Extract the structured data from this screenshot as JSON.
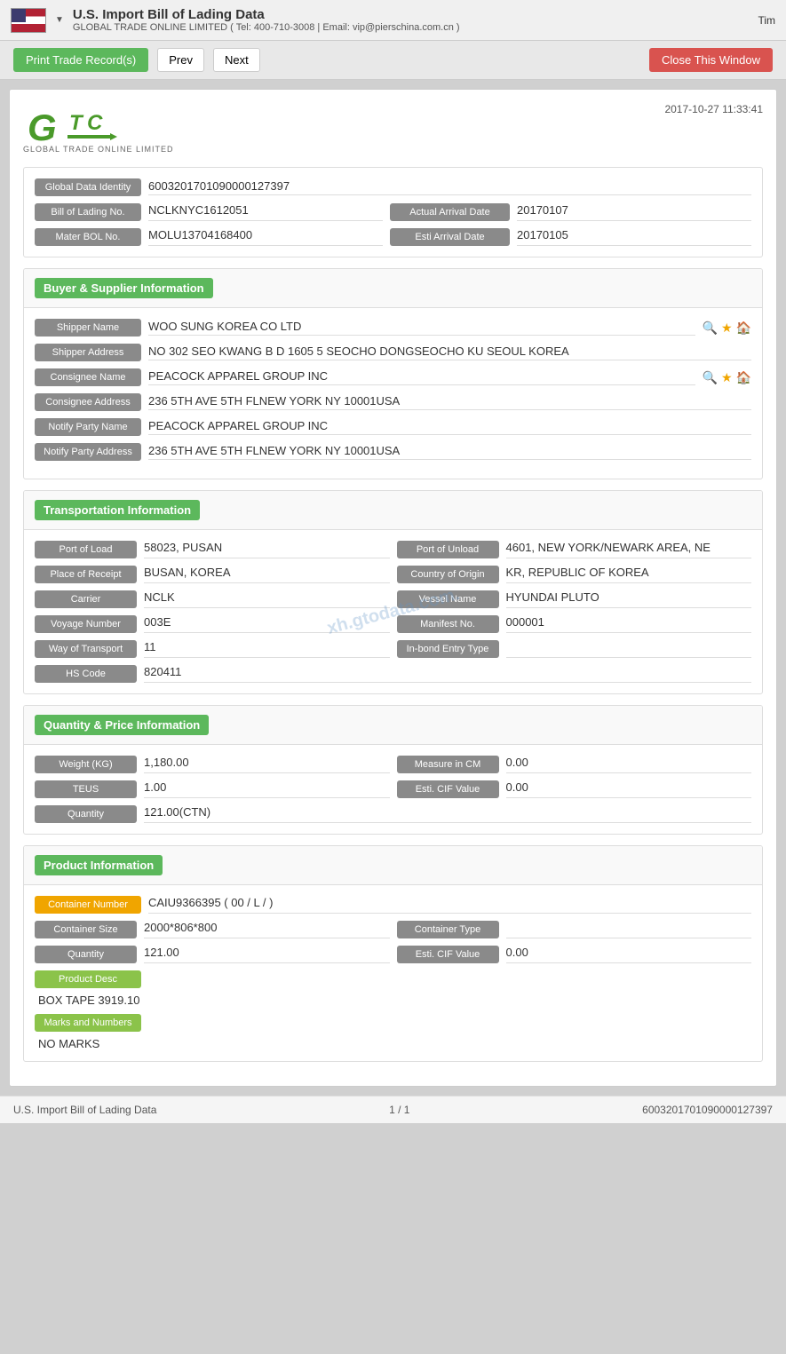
{
  "header": {
    "title": "U.S. Import Bill of Lading Data",
    "dropdown_arrow": "▼",
    "subtitle": "GLOBAL TRADE ONLINE LIMITED ( Tel: 400-710-3008 | Email: vip@pierschina.com.cn )",
    "tim_label": "Tim"
  },
  "toolbar": {
    "print_button": "Print Trade Record(s)",
    "prev_button": "Prev",
    "next_button": "Next",
    "close_button": "Close This Window"
  },
  "document": {
    "logo_text": "GTC",
    "logo_subtitle": "GLOBAL TRADE ONLINE LIMITED",
    "timestamp": "2017-10-27 11:33:41",
    "watermark": "xh.gtodata.com."
  },
  "identity": {
    "global_data_identity_label": "Global Data Identity",
    "global_data_identity_value": "6003201701090000127397",
    "bill_of_lading_label": "Bill of Lading No.",
    "bill_of_lading_value": "NCLKNYC1612051",
    "actual_arrival_label": "Actual Arrival Date",
    "actual_arrival_value": "20170107",
    "mater_bol_label": "Mater BOL No.",
    "mater_bol_value": "MOLU13704168400",
    "esti_arrival_label": "Esti Arrival Date",
    "esti_arrival_value": "20170105"
  },
  "buyer_supplier": {
    "section_title": "Buyer & Supplier Information",
    "shipper_name_label": "Shipper Name",
    "shipper_name_value": "WOO SUNG KOREA CO LTD",
    "shipper_address_label": "Shipper Address",
    "shipper_address_value": "NO 302 SEO KWANG B D 1605 5 SEOCHO DONGSEOCHO KU SEOUL KOREA",
    "consignee_name_label": "Consignee Name",
    "consignee_name_value": "PEACOCK APPAREL GROUP INC",
    "consignee_address_label": "Consignee Address",
    "consignee_address_value": "236 5TH AVE 5TH FLNEW YORK NY 10001USA",
    "notify_party_name_label": "Notify Party Name",
    "notify_party_name_value": "PEACOCK APPAREL GROUP INC",
    "notify_party_address_label": "Notify Party Address",
    "notify_party_address_value": "236 5TH AVE 5TH FLNEW YORK NY 10001USA"
  },
  "transportation": {
    "section_title": "Transportation Information",
    "port_of_load_label": "Port of Load",
    "port_of_load_value": "58023, PUSAN",
    "port_of_unload_label": "Port of Unload",
    "port_of_unload_value": "4601, NEW YORK/NEWARK AREA, NE",
    "place_of_receipt_label": "Place of Receipt",
    "place_of_receipt_value": "BUSAN, KOREA",
    "country_of_origin_label": "Country of Origin",
    "country_of_origin_value": "KR, REPUBLIC OF KOREA",
    "carrier_label": "Carrier",
    "carrier_value": "NCLK",
    "vessel_name_label": "Vessel Name",
    "vessel_name_value": "HYUNDAI PLUTO",
    "voyage_number_label": "Voyage Number",
    "voyage_number_value": "003E",
    "manifest_no_label": "Manifest No.",
    "manifest_no_value": "000001",
    "way_of_transport_label": "Way of Transport",
    "way_of_transport_value": "11",
    "in_bond_entry_label": "In-bond Entry Type",
    "in_bond_entry_value": "",
    "hs_code_label": "HS Code",
    "hs_code_value": "820411"
  },
  "quantity_price": {
    "section_title": "Quantity & Price Information",
    "weight_kg_label": "Weight (KG)",
    "weight_kg_value": "1,180.00",
    "measure_cm_label": "Measure in CM",
    "measure_cm_value": "0.00",
    "teus_label": "TEUS",
    "teus_value": "1.00",
    "esti_cif_label": "Esti. CIF Value",
    "esti_cif_value": "0.00",
    "quantity_label": "Quantity",
    "quantity_value": "121.00(CTN)"
  },
  "product_information": {
    "section_title": "Product Information",
    "container_number_label": "Container Number",
    "container_number_value": "CAIU9366395 ( 00 / L / )",
    "container_size_label": "Container Size",
    "container_size_value": "2000*806*800",
    "container_type_label": "Container Type",
    "container_type_value": "",
    "quantity_label": "Quantity",
    "quantity_value": "121.00",
    "esti_cif_label": "Esti. CIF Value",
    "esti_cif_value": "0.00",
    "product_desc_label": "Product Desc",
    "product_desc_value": "BOX TAPE 3919.10",
    "marks_numbers_label": "Marks and Numbers",
    "marks_numbers_value": "NO MARKS"
  },
  "footer": {
    "left": "U.S. Import Bill of Lading Data",
    "center": "1 / 1",
    "right": "6003201701090000127397"
  }
}
